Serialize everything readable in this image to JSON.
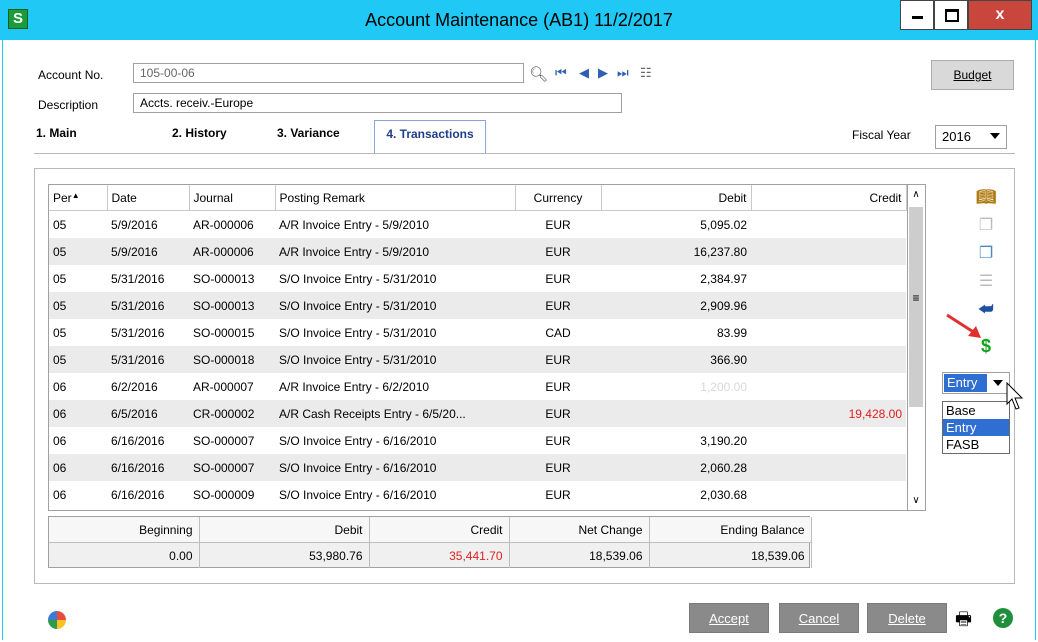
{
  "window": {
    "app_icon_letter": "S",
    "title": "Account Maintenance (AB1) 11/2/2017",
    "close_label": "x"
  },
  "header": {
    "account_no_label": "Account No.",
    "account_no_value": "105-00-06",
    "description_label": "Description",
    "description_value": "Accts. receiv.-Europe",
    "budget_button": "Budget",
    "fiscal_year_label": "Fiscal Year",
    "fiscal_year_value": "2016"
  },
  "tabs": [
    {
      "label": "1. Main",
      "active": false
    },
    {
      "label": "2. History",
      "active": false
    },
    {
      "label": "3. Variance",
      "active": false
    },
    {
      "label": "4. Transactions",
      "active": true
    }
  ],
  "grid": {
    "columns": [
      "Per",
      "Date",
      "Journal",
      "Posting Remark",
      "Currency",
      "Debit",
      "Credit"
    ],
    "rows": [
      {
        "per": "05",
        "date": "5/9/2016",
        "journal": "AR-000006",
        "remark": "A/R Invoice Entry - 5/9/2010",
        "currency": "EUR",
        "debit": "5,095.02",
        "credit": ""
      },
      {
        "per": "05",
        "date": "5/9/2016",
        "journal": "AR-000006",
        "remark": "A/R Invoice Entry - 5/9/2010",
        "currency": "EUR",
        "debit": "16,237.80",
        "credit": ""
      },
      {
        "per": "05",
        "date": "5/31/2016",
        "journal": "SO-000013",
        "remark": "S/O Invoice Entry - 5/31/2010",
        "currency": "EUR",
        "debit": "2,384.97",
        "credit": ""
      },
      {
        "per": "05",
        "date": "5/31/2016",
        "journal": "SO-000013",
        "remark": "S/O Invoice Entry - 5/31/2010",
        "currency": "EUR",
        "debit": "2,909.96",
        "credit": ""
      },
      {
        "per": "05",
        "date": "5/31/2016",
        "journal": "SO-000015",
        "remark": "S/O Invoice Entry - 5/31/2010",
        "currency": "CAD",
        "debit": "83.99",
        "credit": ""
      },
      {
        "per": "05",
        "date": "5/31/2016",
        "journal": "SO-000018",
        "remark": "S/O Invoice Entry - 5/31/2010",
        "currency": "EUR",
        "debit": "366.90",
        "credit": ""
      },
      {
        "per": "06",
        "date": "6/2/2016",
        "journal": "AR-000007",
        "remark": "A/R Invoice Entry - 6/2/2010",
        "currency": "EUR",
        "debit": "1,200.00",
        "credit": ""
      },
      {
        "per": "06",
        "date": "6/5/2016",
        "journal": "CR-000002",
        "remark": "A/R Cash Receipts Entry - 6/5/20...",
        "currency": "EUR",
        "debit": "",
        "credit": "19,428.00"
      },
      {
        "per": "06",
        "date": "6/16/2016",
        "journal": "SO-000007",
        "remark": "S/O Invoice Entry - 6/16/2010",
        "currency": "EUR",
        "debit": "3,190.20",
        "credit": ""
      },
      {
        "per": "06",
        "date": "6/16/2016",
        "journal": "SO-000007",
        "remark": "S/O Invoice Entry - 6/16/2010",
        "currency": "EUR",
        "debit": "2,060.28",
        "credit": ""
      },
      {
        "per": "06",
        "date": "6/16/2016",
        "journal": "SO-000009",
        "remark": "S/O Invoice Entry - 6/16/2010",
        "currency": "EUR",
        "debit": "2,030.68",
        "credit": ""
      }
    ]
  },
  "totals": {
    "headers": [
      "Beginning",
      "Debit",
      "Credit",
      "Net Change",
      "Ending Balance"
    ],
    "values": [
      "0.00",
      "53,980.76",
      "35,441.70",
      "18,539.06",
      "18,539.06"
    ]
  },
  "currency_dropdown": {
    "selected": "Entry",
    "options": [
      "Base",
      "Entry",
      "FASB"
    ]
  },
  "footer": {
    "accept": "Accept",
    "cancel": "Cancel",
    "delete": "Delete",
    "help": "?"
  },
  "colors": {
    "titlebar": "#1fc8f5",
    "credit_red": "#e02020",
    "selection_blue": "#2f6fd2"
  }
}
